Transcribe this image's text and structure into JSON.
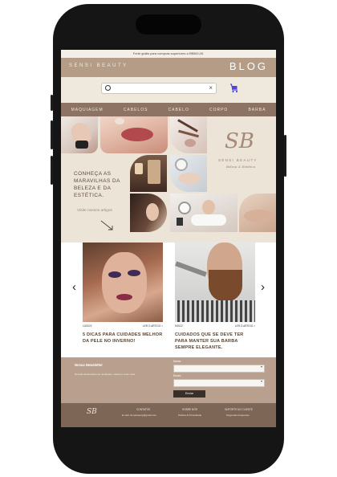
{
  "top_banner": "Frete grátis para compras superiores a R$500,00.",
  "header": {
    "brand": "SENSI BEAUTY",
    "blog": "BLOG"
  },
  "search": {
    "placeholder": "",
    "clear_icon": "×"
  },
  "nav": [
    "MAQUIAGEM",
    "CABELOS",
    "CABELO",
    "CORPO",
    "BARBA"
  ],
  "hero": {
    "logo_monogram": "SB",
    "logo_name": "SENSI BEAUTY",
    "logo_tagline": "Beleza & Estética",
    "title": "CONHEÇA AS MARAVILHAS DA BELEZA E DA ESTÉTICA.",
    "link": "Visite nossos artigos"
  },
  "posts": [
    {
      "date": "10/2022",
      "read": "LER O ARTIGO >",
      "title": "5 DICAS PARA CUIDADES MELHOR DA PELE NO INVERNO!"
    },
    {
      "date": "9/2022",
      "read": "LER O ARTIGO >",
      "title": "CUIDADOS QUE SE DEVE TER PARA MANTER SUA BARBA SEMPRE ELEGANTE."
    }
  ],
  "carousel": {
    "prev": "‹",
    "next": "›"
  },
  "newsletter": {
    "title": "Nossa Newsletter",
    "subtitle": "Receba atualizações de novidades, ofertas e muito mais",
    "name_label": "Nome:",
    "email_label": "Email:",
    "send": "Enviar"
  },
  "footer": {
    "logo": "SB",
    "contact_title": "CONTATOS",
    "contact_email": "E-mail: sb.sebeauty@gmail.com",
    "about_title": "SOBRE NÓS",
    "about_link": "Política & Privacidade",
    "support_title": "SUPORTE AO CLIENTE",
    "support_link": "Perguntas frequentes"
  },
  "colors": {
    "header": "#b59c87",
    "nav": "#8c7363",
    "cream": "#ece4d6",
    "footer": "#7d6656"
  }
}
